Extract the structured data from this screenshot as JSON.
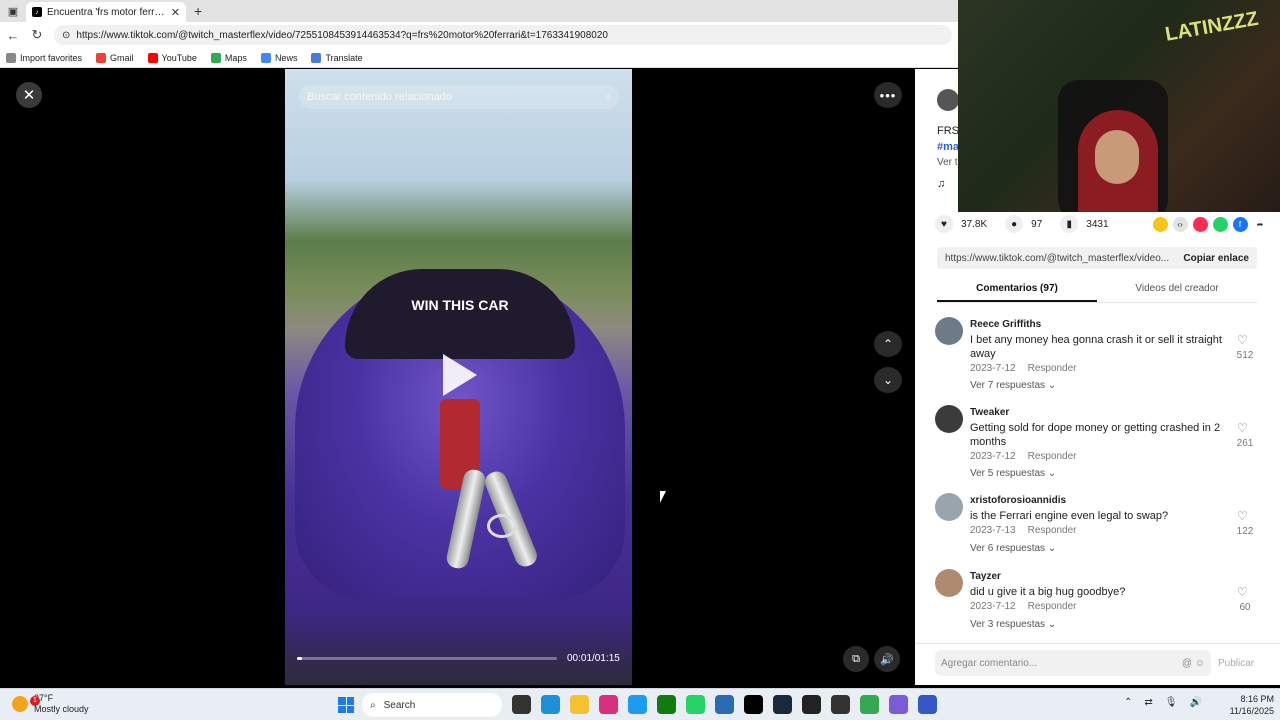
{
  "browser": {
    "tab_title": "Encuentra 'frs motor ferrari' en TikTok",
    "url": "https://www.tiktok.com/@twitch_masterflex/video/7255108453914463534?q=frs%20motor%20ferrari&t=1763341908020",
    "bookmarks": [
      "Import favorites",
      "Gmail",
      "YouTube",
      "Maps",
      "News",
      "Translate"
    ]
  },
  "video": {
    "search_placeholder": "Buscar contenido relacionado",
    "windshield_text": "WIN THIS CAR",
    "time": "00:01/01:15",
    "progress": 0.013
  },
  "creator": {
    "line1": "FRS",
    "line2": "#ma",
    "line3": "Ver t"
  },
  "actions": {
    "likes": "37.8K",
    "comments": "97",
    "saves": "3431"
  },
  "link": {
    "url": "https://www.tiktok.com/@twitch_masterflex/video...",
    "copy_label": "Copiar enlace"
  },
  "tabs": {
    "comments": "Comentarios (97)",
    "creator_videos": "Videos del creador"
  },
  "comments": [
    {
      "name": "Reece Griffiths",
      "text": "I bet any money hea gonna crash it or sell it straight away",
      "date": "2023-7-12",
      "reply": "Responder",
      "likes": "512",
      "replies": "Ver 7 respuestas ⌄"
    },
    {
      "name": "Tweaker",
      "text": "Getting sold for dope money or getting crashed in 2 months",
      "date": "2023-7-12",
      "reply": "Responder",
      "likes": "261",
      "replies": "Ver 5 respuestas ⌄"
    },
    {
      "name": "xristoforosioannidis",
      "text": "is the Ferrari engine even legal to swap?",
      "date": "2023-7-13",
      "reply": "Responder",
      "likes": "122",
      "replies": "Ver 6 respuestas ⌄"
    },
    {
      "name": "Tayzer",
      "text": "did u give it a big hug goodbye?",
      "date": "2023-7-12",
      "reply": "Responder",
      "likes": "60",
      "replies": "Ver 3 respuestas ⌄"
    }
  ],
  "composer": {
    "placeholder": "Agregar comentario...",
    "post_label": "Publicar"
  },
  "webcam": {
    "graffiti": "LATINZZZ"
  },
  "taskbar": {
    "temp": "37°F",
    "weather": "Mostly cloudy",
    "weather_badge": "1",
    "search": "Search",
    "time": "8:16 PM",
    "date": "11/16/2025"
  },
  "colors": {
    "accent_link": "#2b5fd9",
    "video_car": "#4b32a3",
    "windows_blue": "#1f7be0"
  }
}
